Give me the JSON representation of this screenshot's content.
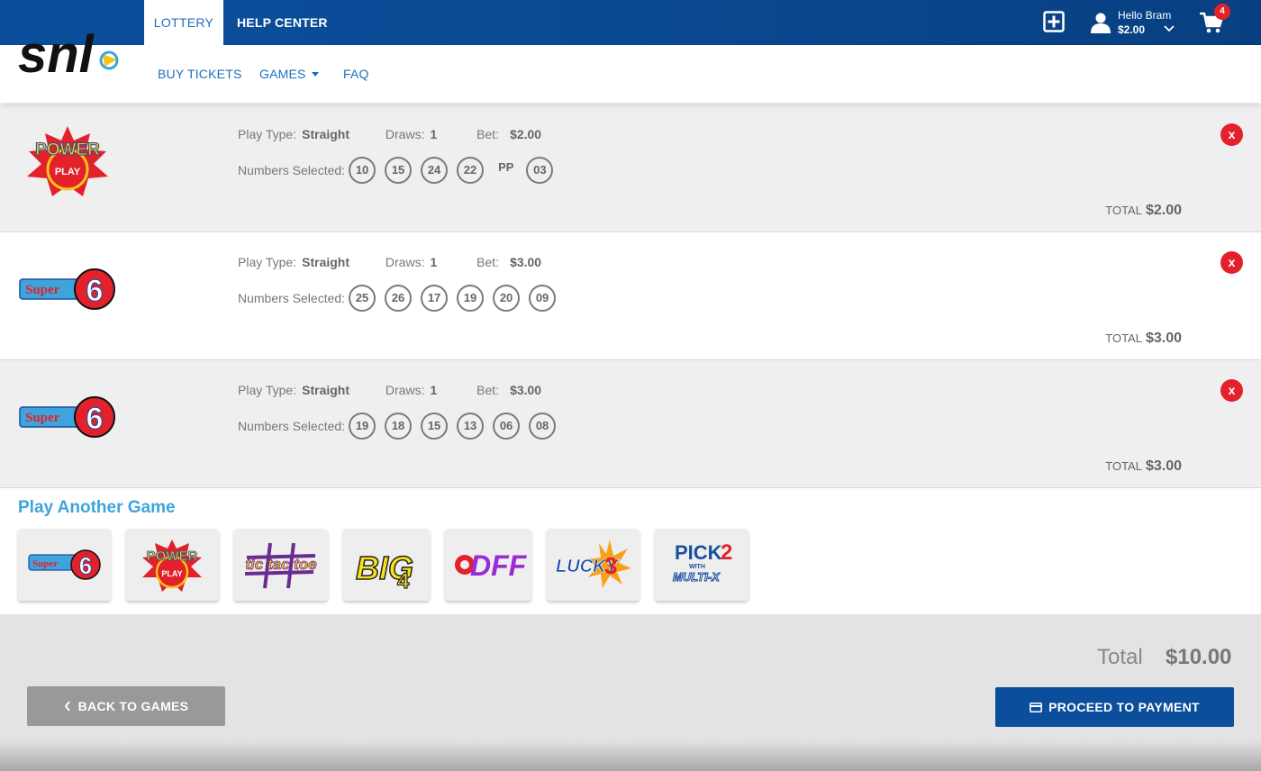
{
  "header": {
    "tabs": [
      {
        "label": "LOTTERY",
        "active": true
      },
      {
        "label": "HELP CENTER",
        "active": false
      }
    ],
    "subnav": [
      {
        "label": "BUY TICKETS"
      },
      {
        "label": "GAMES"
      },
      {
        "label": "FAQ"
      }
    ],
    "user": {
      "greeting": "Hello Bram",
      "balance": "$2.00"
    },
    "cart_count": "4",
    "icons": [
      "plus-square-icon",
      "user-icon",
      "chevron-down-icon",
      "cart-icon"
    ],
    "brand_color": "#0b4f9c"
  },
  "tickets": [
    {
      "game": "power-play",
      "play_type_label": "Play Type:",
      "play_type": "Straight",
      "draws_label": "Draws:",
      "draws": "1",
      "bet_label": "Bet:",
      "bet": "$2.00",
      "numbers_label": "Numbers Selected:",
      "numbers": [
        "10",
        "15",
        "24",
        "22"
      ],
      "pp_label": "PP",
      "pp_number": "03",
      "total_label": "TOTAL",
      "total": "$2.00",
      "remove_label": "x"
    },
    {
      "game": "super-6",
      "play_type_label": "Play Type:",
      "play_type": "Straight",
      "draws_label": "Draws:",
      "draws": "1",
      "bet_label": "Bet:",
      "bet": "$3.00",
      "numbers_label": "Numbers Selected:",
      "numbers": [
        "25",
        "26",
        "17",
        "19",
        "20",
        "09"
      ],
      "total_label": "TOTAL",
      "total": "$3.00",
      "remove_label": "x"
    },
    {
      "game": "super-6",
      "play_type_label": "Play Type:",
      "play_type": "Straight",
      "draws_label": "Draws:",
      "draws": "1",
      "bet_label": "Bet:",
      "bet": "$3.00",
      "numbers_label": "Numbers Selected:",
      "numbers": [
        "19",
        "18",
        "15",
        "13",
        "06",
        "08"
      ],
      "total_label": "TOTAL",
      "total": "$3.00",
      "remove_label": "x"
    }
  ],
  "play_another": {
    "title": "Play Another Game",
    "games": [
      {
        "id": "super-6",
        "logo_text": "Super",
        "logo_text2": "6"
      },
      {
        "id": "power-play",
        "logo_text": "POWER",
        "logo_text2": "PLAY"
      },
      {
        "id": "tic-tac-toe",
        "logo_text": "tic tac toe"
      },
      {
        "id": "big-4",
        "logo_text": "BIG",
        "logo_text2": "4"
      },
      {
        "id": "doff",
        "logo_text": "DFF"
      },
      {
        "id": "lucky-3",
        "logo_text": "LUCKY",
        "logo_text2": "3"
      },
      {
        "id": "pick-2-multi-x",
        "logo_text": "PICK",
        "logo_text2": "2",
        "logo_text3": "WITH",
        "logo_text4": "MULTI-X"
      }
    ]
  },
  "footer": {
    "total_label": "Total",
    "total": "$10.00",
    "back_label": "BACK TO GAMES",
    "pay_label": "PROCEED TO PAYMENT"
  },
  "logo": {
    "text": "snl"
  }
}
